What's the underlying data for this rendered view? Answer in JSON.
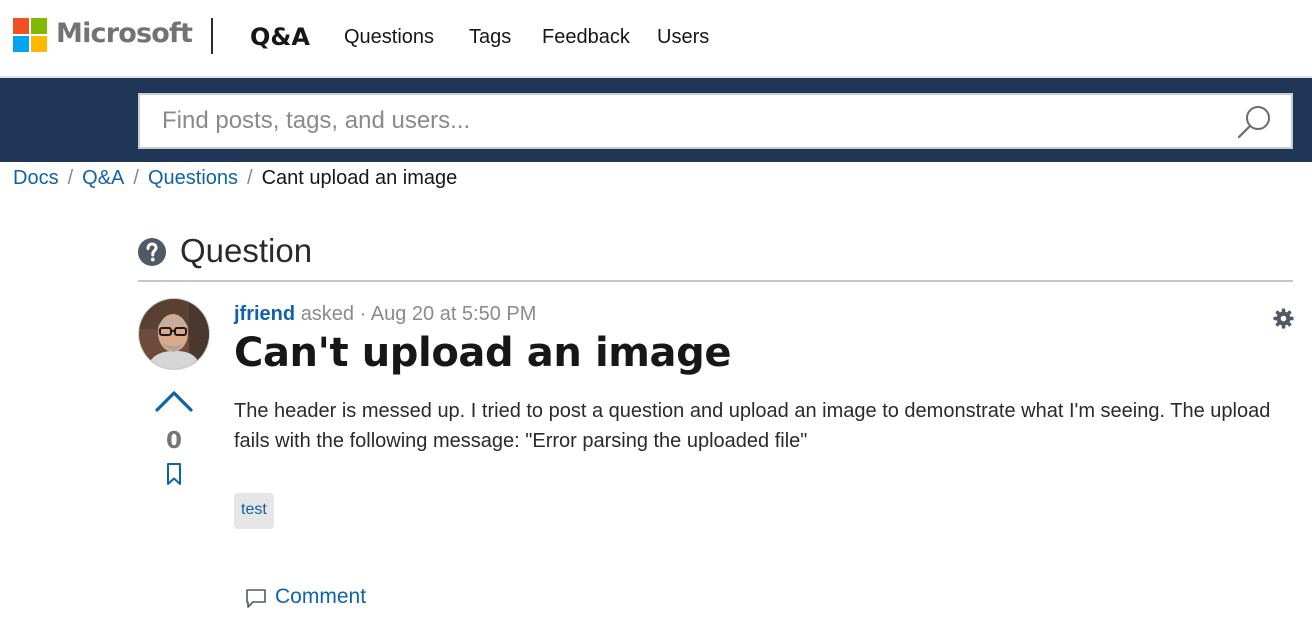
{
  "header": {
    "brand": "Microsoft",
    "product": "Q&A",
    "nav": [
      "Questions",
      "Tags",
      "Feedback",
      "Users"
    ]
  },
  "search": {
    "placeholder": "Find posts, tags, and users...",
    "value": "",
    "icon": "search-icon"
  },
  "breadcrumb": {
    "items": [
      "Docs",
      "Q&A",
      "Questions"
    ],
    "separator": "/",
    "current": "Cant upload an image"
  },
  "section": {
    "heading": "Question",
    "icon": "question-circle-icon"
  },
  "question": {
    "author": "jfriend",
    "action": "asked",
    "separator": "·",
    "timestamp": "Aug 20 at 5:50 PM",
    "title": "Can't upload an image",
    "body": "The header is messed up. I tried to post a question and upload an image to demonstrate what I'm seeing. The upload fails with the following message: \"Error parsing the uploaded file\"",
    "votes": "0",
    "tags": [
      "test"
    ],
    "comment_label": "Comment"
  },
  "colors": {
    "link": "#0f63a8",
    "search_band": "#1f3656",
    "logo_red": "#f25022",
    "logo_green": "#7fba00",
    "logo_blue": "#00a4ef",
    "logo_yellow": "#ffb900"
  }
}
